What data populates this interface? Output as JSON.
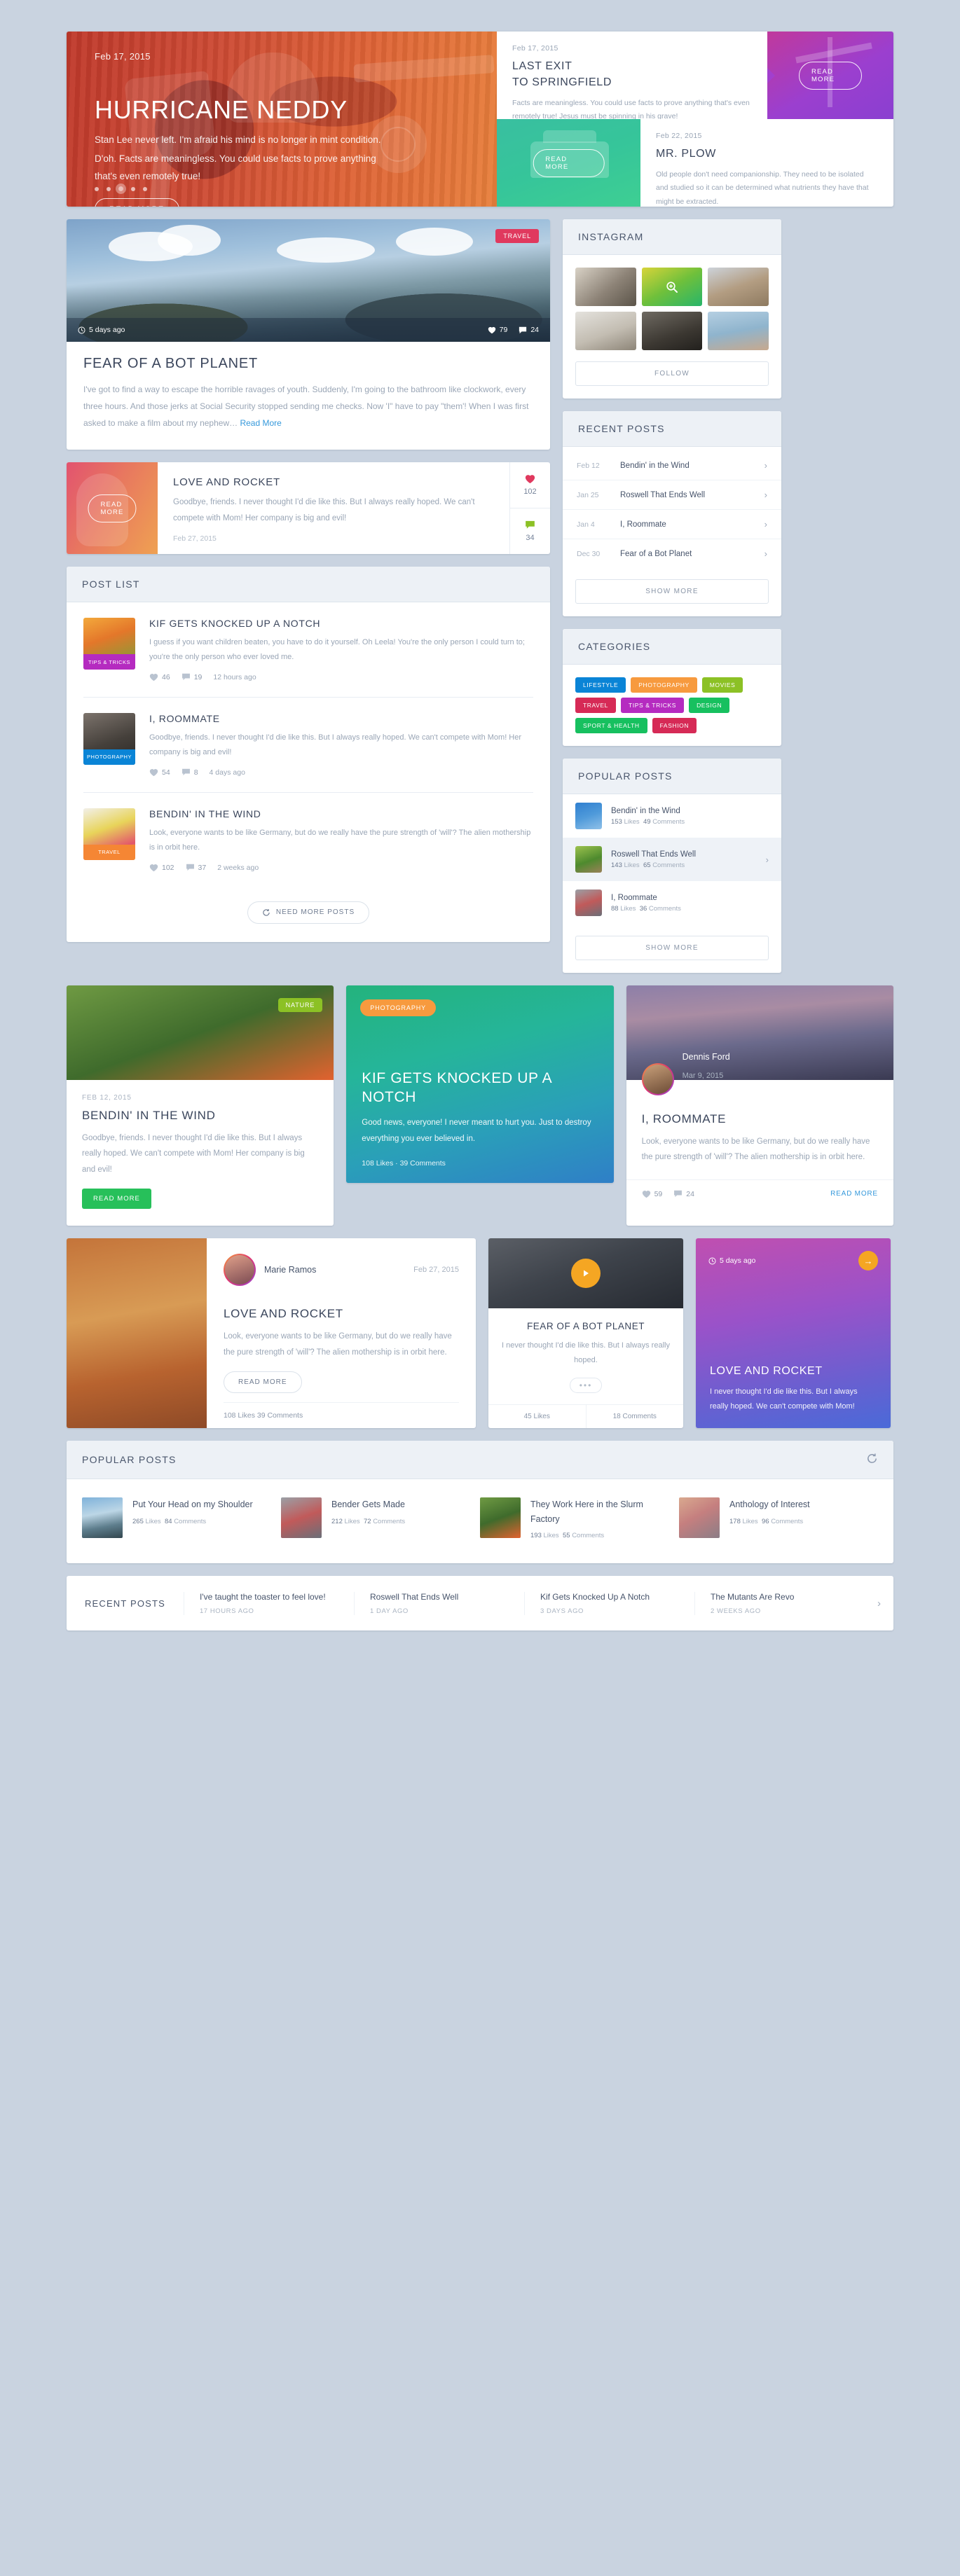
{
  "hero": {
    "main": {
      "date": "Feb 17, 2015",
      "title": "HURRICANE NEDDY",
      "text_line1": "Stan Lee never left. I'm afraid his mind is no longer in mint condition.",
      "text_line2": "D'oh. Facts are meaningless. You could use facts to prove anything that's even remotely true!",
      "button": "READ MORE"
    },
    "card_last_exit": {
      "date": "Feb 17, 2015",
      "title_line1": "LAST EXIT",
      "title_line2": "TO SPRINGFIELD",
      "body": "Facts are meaningless. You could use facts to prove anything that's even remotely true! Jesus must be spinning in his grave!"
    },
    "tile_purple_button": "READ MORE",
    "tile_mint_button": "READ MORE",
    "card_mr_plow": {
      "date": "Feb 22, 2015",
      "title": "MR. PLOW",
      "body": "Old people don't need companionship. They need to be isolated and studied so it can be determined what nutrients they have that might be extracted."
    }
  },
  "feature": {
    "badge": "TRAVEL",
    "time_ago": "5 days ago",
    "likes": "79",
    "comments": "24",
    "title": "FEAR OF A BOT PLANET",
    "text": "I've got to find a way to escape the horrible ravages of youth. Suddenly, I'm going to the bathroom like clockwork, every three hours. And those jerks at Social Security stopped sending me checks. Now 'I\" have to pay \"them'! When I was first asked to make a film about my nephew…",
    "read_more": "Read More"
  },
  "love_rocket_row": {
    "image_button": "READ MORE",
    "title": "LOVE AND ROCKET",
    "text": "Goodbye, friends. I never thought I'd die like this. But I always really hoped. We can't compete with Mom! Her company is big and evil!",
    "date": "Feb 27, 2015",
    "likes": "102",
    "comments": "34"
  },
  "post_list": {
    "header": "POST LIST",
    "more_button": "NEED MORE POSTS",
    "items": [
      {
        "tag": "TIPS & TRICKS",
        "tag_color": "#b52bc0",
        "title": "KIF GETS KNOCKED UP A NOTCH",
        "text": "I guess if you want children beaten, you have to do it yourself. Oh Leela! You're the only person I could turn to; you're the only person who ever loved me.",
        "likes": "46",
        "comments": "19",
        "time": "12 hours ago"
      },
      {
        "tag": "PHOTOGRAPHY",
        "tag_color": "#0a84d6",
        "title": "I, ROOMMATE",
        "text": "Goodbye, friends. I never thought I'd die like this. But I always really hoped. We can't compete with Mom! Her company is big and evil!",
        "likes": "54",
        "comments": "8",
        "time": "4 days ago"
      },
      {
        "tag": "TRAVEL",
        "tag_color": "#f58634",
        "title": "BENDIN' IN THE WIND",
        "text": "Look, everyone wants to be like Germany, but do we really have the pure strength of 'will'? The alien mothership is in orbit here.",
        "likes": "102",
        "comments": "37",
        "time": "2 weeks ago"
      }
    ]
  },
  "instagram": {
    "header": "INSTAGRAM",
    "follow_button": "FOLLOW"
  },
  "recent_posts_side": {
    "header": "RECENT POSTS",
    "show_more": "SHOW MORE",
    "items": [
      {
        "date": "Feb 12",
        "title": "Bendin' in the Wind"
      },
      {
        "date": "Jan 25",
        "title": "Roswell That Ends Well"
      },
      {
        "date": "Jan 4",
        "title": "I, Roommate"
      },
      {
        "date": "Dec 30",
        "title": "Fear of a Bot Planet"
      }
    ]
  },
  "categories": {
    "header": "CATEGORIES",
    "items": [
      {
        "label": "LIFESTYLE",
        "color": "#0a84d6"
      },
      {
        "label": "PHOTOGRAPHY",
        "color": "#f79a3e"
      },
      {
        "label": "MOVIES",
        "color": "#8cc125"
      },
      {
        "label": "TRAVEL",
        "color": "#d62a56"
      },
      {
        "label": "TIPS & TRICKS",
        "color": "#b52bc0"
      },
      {
        "label": "DESIGN",
        "color": "#17c05f"
      },
      {
        "label": "SPORT & HEALTH",
        "color": "#17c05f"
      },
      {
        "label": "FASHION",
        "color": "#d62a56"
      }
    ]
  },
  "popular_posts_side": {
    "header": "POPULAR POSTS",
    "show_more": "SHOW MORE",
    "items": [
      {
        "title": "Bendin' in the Wind",
        "likes": "153",
        "likes_label": "Likes",
        "comments": "49",
        "comments_label": "Comments",
        "thumb": "p-bird"
      },
      {
        "title": "Roswell That Ends Well",
        "likes": "143",
        "likes_label": "Likes",
        "comments": "65",
        "comments_label": "Comments",
        "thumb": "p-bean"
      },
      {
        "title": "I, Roommate",
        "likes": "88",
        "likes_label": "Likes",
        "comments": "36",
        "comments_label": "Comments",
        "thumb": "p-girl"
      }
    ]
  },
  "cards3": {
    "nature": {
      "badge": "NATURE",
      "date": "FEB 12, 2015",
      "title": "BENDIN' IN THE WIND",
      "text": "Goodbye, friends. I never thought I'd die like this. But I always really hoped. We can't compete with Mom! Her company is big and evil!",
      "button": "READ MORE"
    },
    "photography": {
      "badge": "PHOTOGRAPHY",
      "title": "KIF GETS KNOCKED UP A NOTCH",
      "text": "Good news, everyone! I never meant to hurt you. Just to destroy everything you ever believed in.",
      "meta": "108 Likes  ·  39 Comments"
    },
    "author_card": {
      "author": "Dennis Ford",
      "date": "Mar 9, 2015",
      "title": "I, ROOMMATE",
      "text": "Look, everyone wants to be like Germany, but do we really have the pure strength of 'will'? The alien mothership is in orbit here.",
      "likes": "59",
      "comments": "24",
      "read_more": "READ MORE"
    }
  },
  "bottom_row": {
    "wide": {
      "author": "Marie Ramos",
      "date": "Feb 27, 2015",
      "title": "LOVE AND ROCKET",
      "text": "Look, everyone wants to be like Germany, but do we really have the pure strength of 'will'? The alien mothership is in orbit here.",
      "button": "READ MORE",
      "footer": "108 Likes   39 Comments"
    },
    "video": {
      "title": "FEAR OF A BOT PLANET",
      "text": "I never thought I'd die like this. But I always really hoped.",
      "ellipsis": "•••",
      "likes": "45 Likes",
      "comments": "18 Comments"
    },
    "gradient": {
      "time_ago": "5 days ago",
      "arrow": "→",
      "title": "LOVE AND ROCKET",
      "text": "I never thought I'd die like this. But I always really hoped. We can't compete with Mom!"
    }
  },
  "footer_popular": {
    "header": "POPULAR POSTS",
    "items": [
      {
        "title": "Put Your Head on my Shoulder",
        "likes": "265",
        "likes_label": "Likes",
        "comments": "84",
        "comments_label": "Comments",
        "thumb": "p-lake"
      },
      {
        "title": "Bender Gets Made",
        "likes": "212",
        "likes_label": "Likes",
        "comments": "72",
        "comments_label": "Comments",
        "thumb": "p-girl"
      },
      {
        "title": "They Work Here in the Slurm Factory",
        "likes": "193",
        "likes_label": "Likes",
        "comments": "55",
        "comments_label": "Comments",
        "thumb": "p-tea"
      },
      {
        "title": "Anthology of Interest",
        "likes": "178",
        "likes_label": "Likes",
        "comments": "96",
        "comments_label": "Comments",
        "thumb": "p-owl"
      }
    ]
  },
  "footer_recent": {
    "label": "RECENT POSTS",
    "items": [
      {
        "title": "I've taught the toaster to feel love!",
        "date": "17 HOURS AGO"
      },
      {
        "title": "Roswell That Ends Well",
        "date": "1 DAY AGO"
      },
      {
        "title": "Kif Gets Knocked Up A Notch",
        "date": "3 DAYS AGO"
      },
      {
        "title": "The Mutants Are Revo",
        "date": "2 WEEKS AGO"
      }
    ]
  }
}
